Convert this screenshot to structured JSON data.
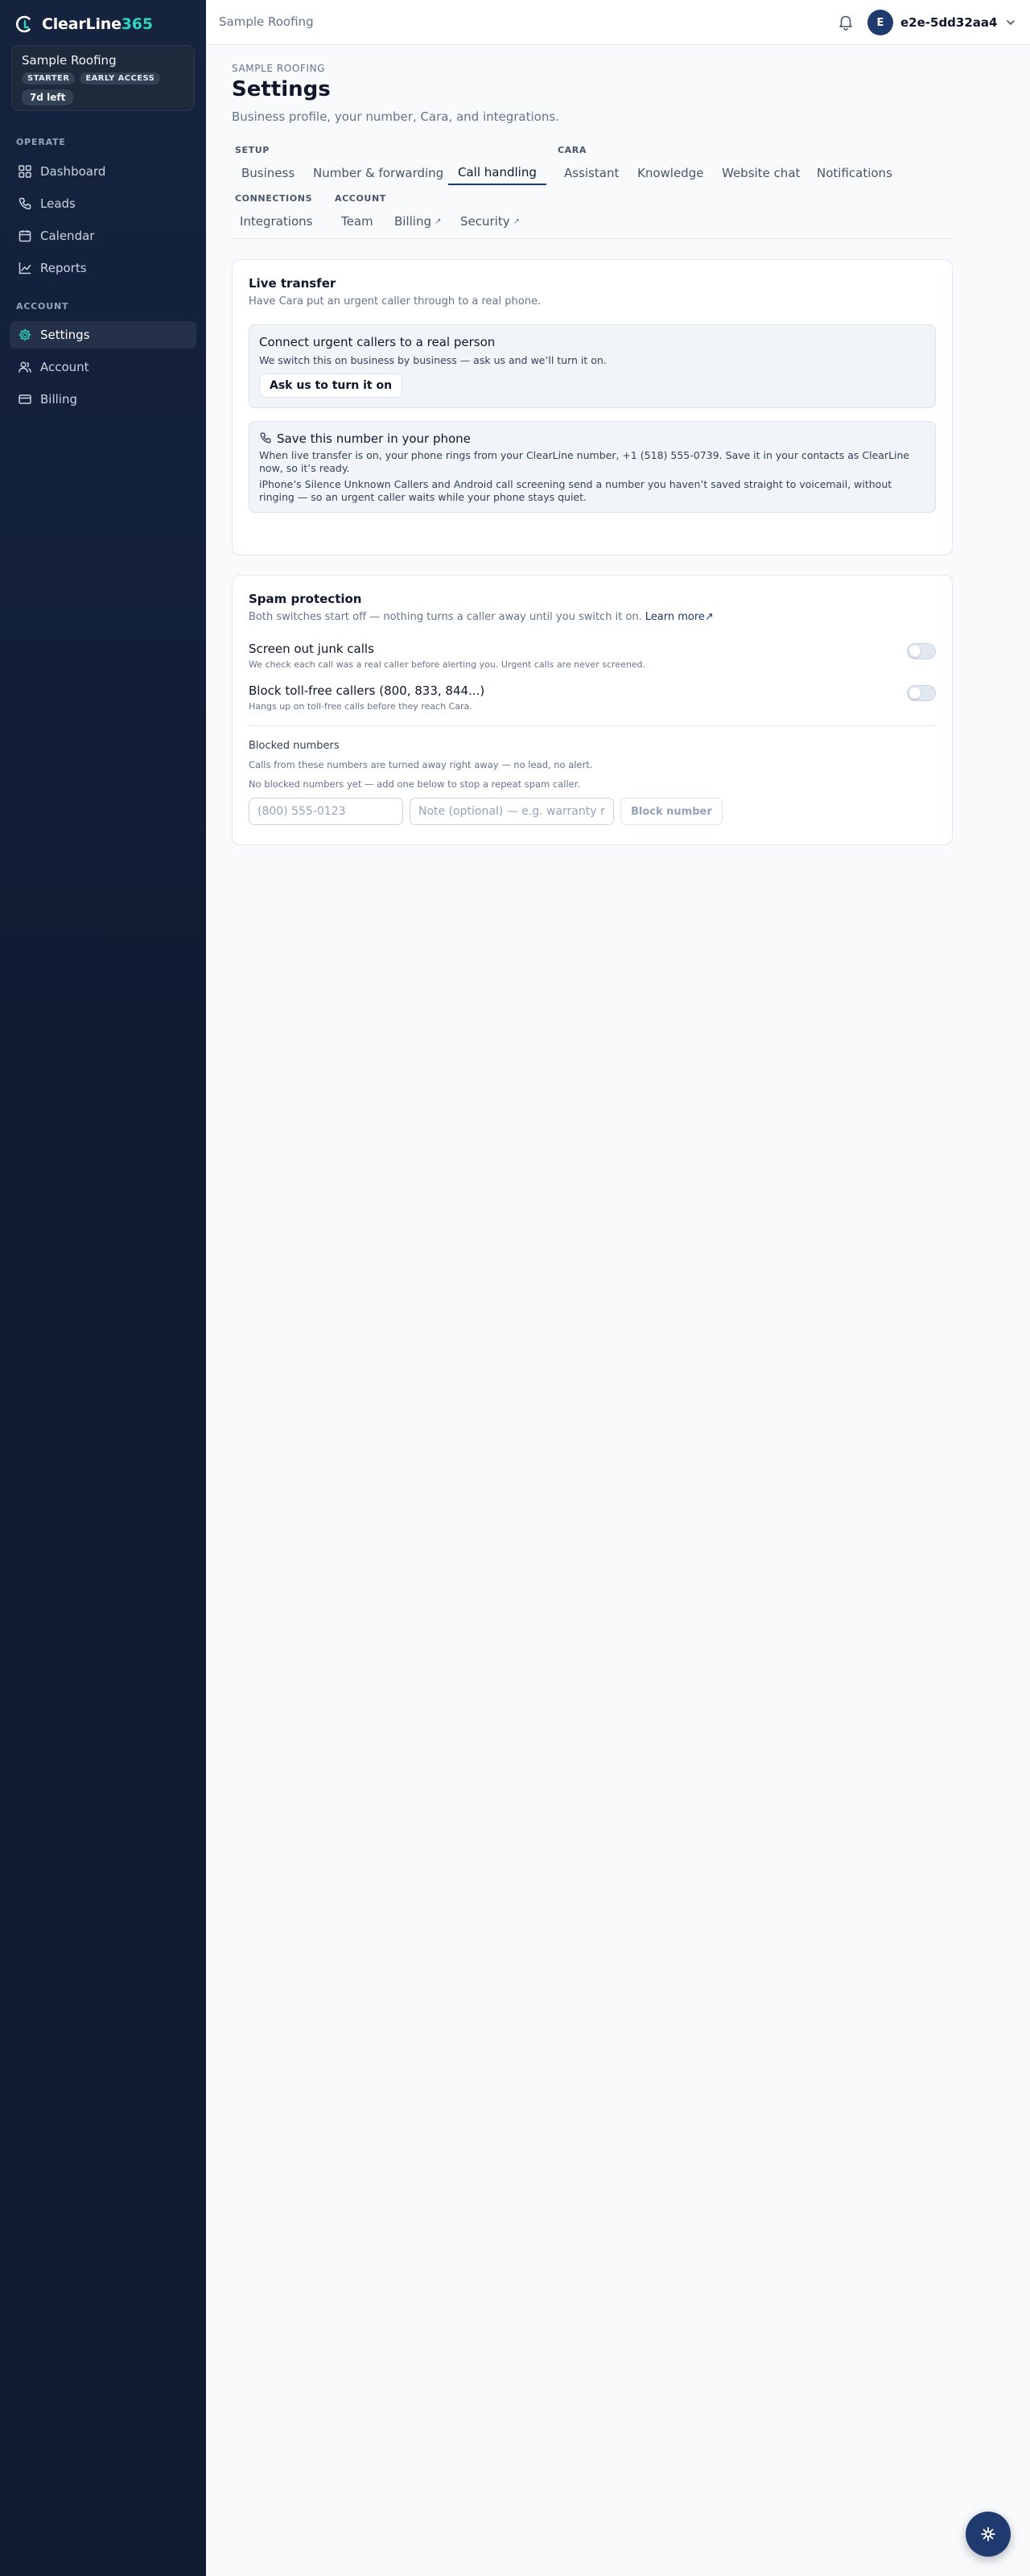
{
  "sidebar": {
    "logo": {
      "text": "ClearLine",
      "accent": "365"
    },
    "business": {
      "name": "Sample Roofing",
      "badges": [
        "STARTER",
        "EARLY ACCESS"
      ],
      "trial": "7d left"
    },
    "sections": [
      {
        "label": "OPERATE",
        "items": [
          {
            "label": "Dashboard",
            "icon": "grid-icon"
          },
          {
            "label": "Leads",
            "icon": "phone-icon"
          },
          {
            "label": "Calendar",
            "icon": "calendar-icon"
          },
          {
            "label": "Reports",
            "icon": "chart-icon"
          }
        ]
      },
      {
        "label": "ACCOUNT",
        "items": [
          {
            "label": "Settings",
            "icon": "gear-icon",
            "active": true
          },
          {
            "label": "Account",
            "icon": "users-icon"
          },
          {
            "label": "Billing",
            "icon": "card-icon"
          }
        ]
      }
    ]
  },
  "topbar": {
    "breadcrumb": "Sample Roofing",
    "avatar_initial": "E",
    "user": "e2e-5dd32aa4"
  },
  "header": {
    "eyebrow": "SAMPLE ROOFING",
    "title": "Settings",
    "subtitle": "Business profile, your number, Cara, and integrations."
  },
  "tabs": {
    "groups": {
      "setup": "SETUP",
      "cara": "CARA",
      "connections": "CONNECTIONS",
      "account": "ACCOUNT"
    },
    "business": "Business",
    "number": "Number & forwarding",
    "call_handling": "Call handling",
    "assistant": "Assistant",
    "knowledge": "Knowledge",
    "website_chat": "Website chat",
    "notifications": "Notifications",
    "integrations": "Integrations",
    "team": "Team",
    "billing": "Billing",
    "security": "Security",
    "external_marker": "↗"
  },
  "live_transfer": {
    "title": "Live transfer",
    "subtitle": "Have Cara put an urgent caller through to a real phone.",
    "connect": {
      "title": "Connect urgent callers to a real person",
      "text": "We switch this on business by business — ask us and we’ll turn it on.",
      "button": "Ask us to turn it on"
    },
    "save_number": {
      "title": "Save this number in your phone",
      "text1": "When live transfer is on, your phone rings from your ClearLine number, +1 (518) 555-0739. Save it in your contacts as ClearLine now, so it’s ready.",
      "text2": "iPhone’s Silence Unknown Callers and Android call screening send a number you haven’t saved straight to voicemail, without ringing — so an urgent caller waits while your phone stays quiet."
    }
  },
  "spam": {
    "title": "Spam protection",
    "subtitle": "Both switches start off — nothing turns a caller away until you switch it on.",
    "learn_more": "Learn more↗",
    "junk": {
      "label": "Screen out junk calls",
      "help": "We check each call was a real caller before alerting you. Urgent calls are never screened.",
      "on": false
    },
    "tollfree": {
      "label": "Block toll-free callers (800, 833, 844...)",
      "help": "Hangs up on toll-free calls before they reach Cara.",
      "on": false
    },
    "blocked": {
      "title": "Blocked numbers",
      "text": "Calls from these numbers are turned away right away — no lead, no alert.",
      "empty": "No blocked numbers yet — add one below to stop a repeat spam caller.",
      "number_placeholder": "(800) 555-0123",
      "note_placeholder": "Note (optional) — e.g. warranty robocall",
      "button": "Block number"
    }
  },
  "colors": {
    "accent": "#2dd4bf",
    "brand": "#1e3a6e",
    "sidebar": "#111c33"
  }
}
